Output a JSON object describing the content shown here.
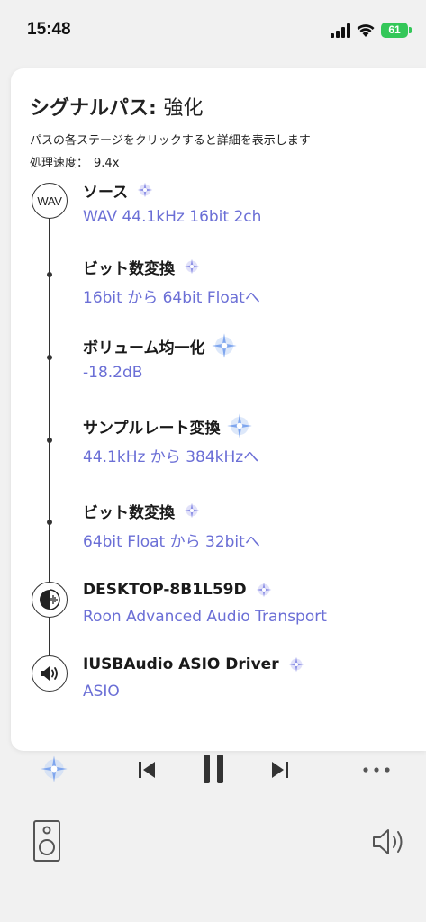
{
  "status": {
    "time": "15:48",
    "battery": "61"
  },
  "panel": {
    "title": "シグナルパス:",
    "strength": "強化",
    "subtitle": "パスの各ステージをクリックすると詳細を表示します",
    "speed_label": "処理速度：",
    "speed_value": "9.4x"
  },
  "source_icon_label": "WAV",
  "stages": [
    {
      "title": "ソース",
      "detail": "WAV 44.1kHz 16bit 2ch"
    },
    {
      "title": "ビット数変換",
      "detail": "16bit から 64bit Floatへ"
    },
    {
      "title": "ボリューム均一化",
      "detail": "-18.2dB"
    },
    {
      "title": "サンプルレート変換",
      "detail": "44.1kHz から 384kHzへ"
    },
    {
      "title": "ビット数変換",
      "detail": "64bit Float から 32bitへ"
    },
    {
      "title": "DESKTOP-8B1L59D",
      "detail": "Roon Advanced Audio Transport"
    },
    {
      "title": "IUSBAudio ASIO Driver",
      "detail": "ASIO"
    }
  ],
  "colors": {
    "accent": "#6b6fd6",
    "line": "#333333",
    "battery": "#34c759"
  },
  "icons": {
    "signal": "cellular-signal-icon",
    "wifi": "wifi-icon",
    "sparkle": "sparkle-icon",
    "prev": "skip-previous-icon",
    "pause": "pause-icon",
    "next": "skip-next-icon",
    "more": "more-icon",
    "speaker": "speaker-icon",
    "volume": "volume-icon"
  }
}
